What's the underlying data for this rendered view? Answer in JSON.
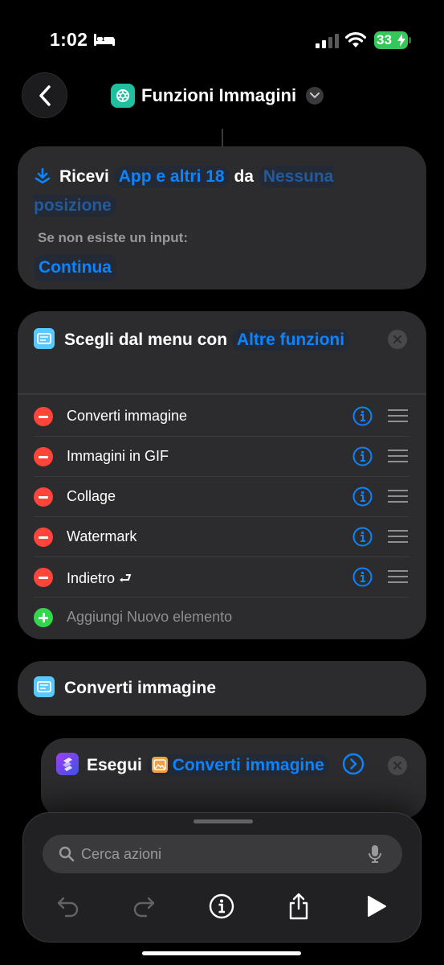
{
  "status_bar": {
    "time": "1:02",
    "battery": "33",
    "icons": [
      "bed-icon",
      "signal-icon",
      "wifi-icon",
      "battery-icon"
    ]
  },
  "nav": {
    "title": "Funzioni Immagini",
    "back_icon": "chevron-left-icon",
    "app_icon": "openai-logo-icon",
    "title_icon": "chevron-down-icon"
  },
  "receive_action": {
    "verb": "Ricevi",
    "input_types": "App e altri 18",
    "from_word": "da",
    "source": "Nessuna posizione",
    "no_input_label": "Se non esiste un input:",
    "no_input_action": "Continua"
  },
  "menu_action": {
    "label": "Scegli dal menu con",
    "prompt": "Altre funzioni",
    "items": [
      {
        "label": "Converti immagine"
      },
      {
        "label": "Immagini in GIF"
      },
      {
        "label": "Collage"
      },
      {
        "label": "Watermark"
      },
      {
        "label": "Indietro ⮐"
      }
    ],
    "add_label": "Aggiungi Nuovo elemento"
  },
  "menu_case": {
    "title": "Converti immagine"
  },
  "run_action": {
    "verb": "Esegui",
    "shortcut_name": "Converti immagine"
  },
  "bottom_panel": {
    "search_placeholder": "Cerca azioni",
    "toolbar_icons": [
      "undo-icon",
      "redo-icon",
      "info-icon",
      "share-icon",
      "play-icon"
    ]
  },
  "colors": {
    "accent": "#0a84ff",
    "card": "#2c2c2e",
    "delete": "#ff453a",
    "add": "#32d74b",
    "battery": "#34c759"
  }
}
